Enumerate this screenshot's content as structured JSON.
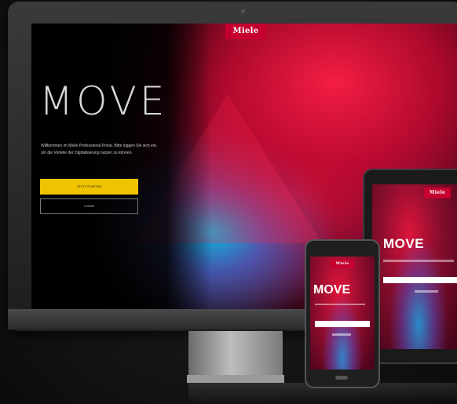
{
  "brand": {
    "name": "Miele"
  },
  "hero": {
    "title": "MOVE",
    "intro": "Willkommen im Miele Professional Portal. Bitte loggen Sie sich ein, um die Vorteile der Digitalisierung nutzen zu können.",
    "primary_button": "Jetzt starten",
    "secondary_button": "Login"
  },
  "tablet": {
    "title": "MOVE"
  },
  "phone": {
    "title": "MOVE"
  },
  "colors": {
    "brand_red": "#c5002f",
    "button_yellow": "#f0c300",
    "background_dark": "#151516"
  }
}
